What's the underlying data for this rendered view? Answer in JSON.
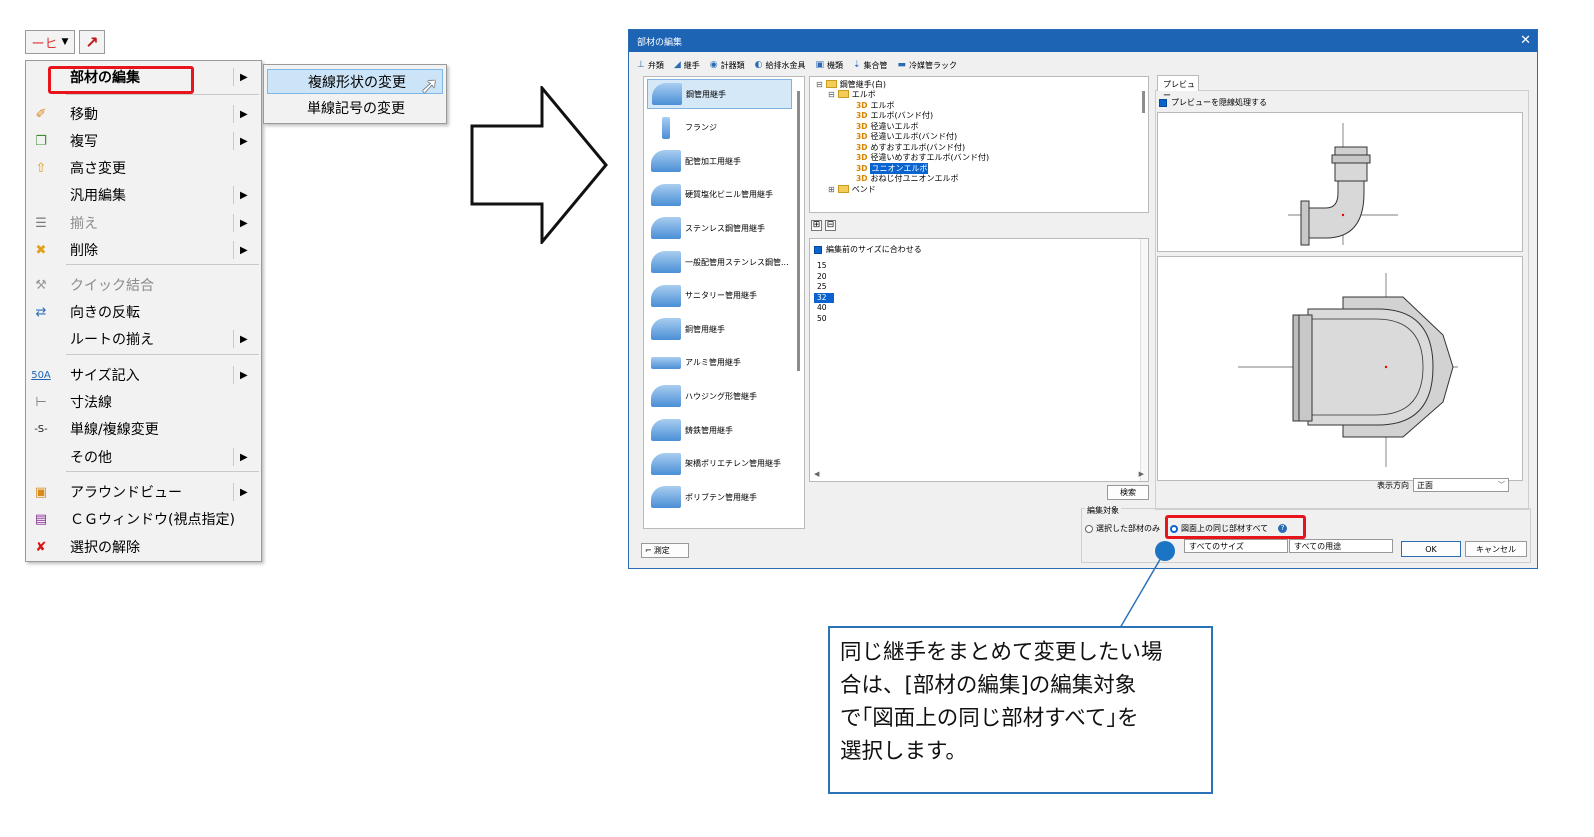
{
  "toolbar": {
    "line_glyph": "ーヒ",
    "dropdown_glyph": "▼",
    "arrow_glyph": "↗"
  },
  "context_menu": {
    "items": [
      {
        "label": "部材の編集",
        "icon": "",
        "has_submenu": true,
        "disabled": false
      },
      {
        "label": "移動",
        "icon": "move-icon",
        "has_submenu": true,
        "disabled": false
      },
      {
        "label": "複写",
        "icon": "copy-icon",
        "has_submenu": true,
        "disabled": false
      },
      {
        "label": "高さ変更",
        "icon": "height-change-icon",
        "has_submenu": false,
        "disabled": false
      },
      {
        "label": "汎用編集",
        "icon": "",
        "has_submenu": true,
        "disabled": false
      },
      {
        "label": "揃え",
        "icon": "align-icon",
        "has_submenu": true,
        "disabled": true
      },
      {
        "label": "削除",
        "icon": "delete-icon",
        "has_submenu": true,
        "disabled": false
      },
      {
        "label": "クイック結合",
        "icon": "quick-join-icon",
        "has_submenu": false,
        "disabled": true
      },
      {
        "label": "向きの反転",
        "icon": "flip-icon",
        "has_submenu": false,
        "disabled": false
      },
      {
        "label": "ルートの揃え",
        "icon": "",
        "has_submenu": true,
        "disabled": false
      },
      {
        "label": "サイズ記入",
        "icon": "size-label-icon",
        "icon_text": "50A",
        "has_submenu": true,
        "disabled": false
      },
      {
        "label": "寸法線",
        "icon": "dimension-line-icon",
        "has_submenu": false,
        "disabled": false
      },
      {
        "label": "単線/複線変更",
        "icon": "line-toggle-icon",
        "icon_text": "-S-",
        "has_submenu": false,
        "disabled": false
      },
      {
        "label": "その他",
        "icon": "",
        "has_submenu": true,
        "disabled": false
      },
      {
        "label": "アラウンドビュー",
        "icon": "around-view-icon",
        "has_submenu": true,
        "disabled": false
      },
      {
        "label": "ＣＧウィンドウ(視点指定)",
        "icon": "cg-window-icon",
        "has_submenu": false,
        "disabled": false
      },
      {
        "label": "選択の解除",
        "icon": "deselect-icon",
        "has_submenu": false,
        "disabled": false
      }
    ]
  },
  "submenu": {
    "items": [
      "複線形状の変更",
      "単線記号の変更"
    ]
  },
  "dialog": {
    "title": "部材の編集",
    "close_glyph": "✕",
    "tabs": [
      "弁類",
      "継手",
      "計器類",
      "給排水金具",
      "機類",
      "集合管",
      "冷媒管ラック"
    ],
    "parts": [
      "鋼管用継手",
      "フランジ",
      "配管加工用継手",
      "硬質塩化ビニル管用継手",
      "ステンレス鋼管用継手",
      "一般配管用ステンレス鋼管...",
      "サニタリー管用継手",
      "銅管用継手",
      "アルミ管用継手",
      "ハウジング形管継手",
      "鋳鉄管用継手",
      "架橋ポリエチレン管用継手",
      "ポリブテン管用継手"
    ],
    "tree": {
      "root": "鋼管継手(白)",
      "group": "エルボ",
      "leaves": [
        "エルボ",
        "エルボ(バンド付)",
        "径違いエルボ",
        "径違いエルボ(バンド付)",
        "めすおすエルボ(バンド付)",
        "径違いめすおすエルボ(バンド付)",
        "ユニオンエルボ",
        "おねじ付ユニオンエルボ"
      ],
      "badge": "3D",
      "selected": "ユニオンエルボ",
      "next_group": "ベンド",
      "expand_glyph": "⊞",
      "collapse_glyph": "⊟"
    },
    "match_size_label": "編集前のサイズに合わせる",
    "sizes": [
      "15",
      "20",
      "25",
      "32",
      "40",
      "50"
    ],
    "selected_size": "32",
    "search_button": "検索",
    "preview_tab": "プレビュー",
    "preview_hide_label": "プレビューを隠線処理する",
    "view_dir_label": "表示方向",
    "view_dir_value": "正面",
    "edit_target_label": "編集対象",
    "radio_selected_only": "選択した部材のみ",
    "radio_all_same": "図面上の同じ部材すべて",
    "size_filter": "すべてのサイズ",
    "use_filter": "すべての用途",
    "ok_button": "OK",
    "cancel_button": "キャンセル",
    "measure_button": "測定"
  },
  "callout": {
    "text": "同じ継手をまとめて変更したい場\n合は、[部材の編集]の編集対象\nで｢図面上の同じ部材すべて｣を\n選択します。"
  },
  "colors": {
    "highlight": "#e8141b",
    "accent": "#1e64b4",
    "callout_border": "#2a73b8"
  }
}
